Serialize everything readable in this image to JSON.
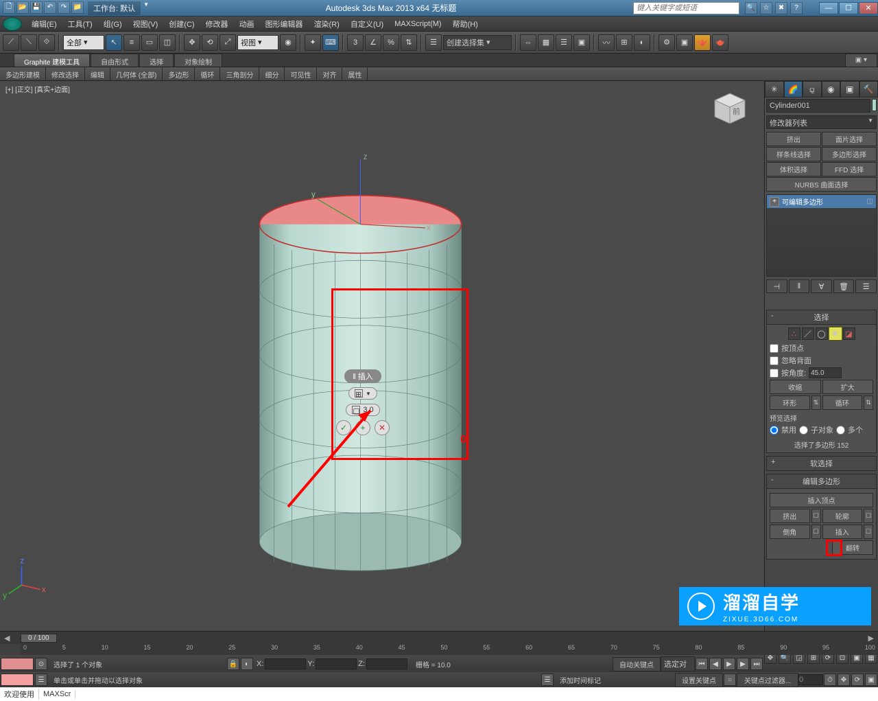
{
  "titlebar": {
    "workspace": "工作台: 默认",
    "app_title": "Autodesk 3ds Max  2013 x64     无标题",
    "search_placeholder": "键入关键字或短语"
  },
  "menu": {
    "items": [
      "编辑(E)",
      "工具(T)",
      "组(G)",
      "视图(V)",
      "创建(C)",
      "修改器",
      "动画",
      "图形编辑器",
      "渲染(R)",
      "自定义(U)",
      "MAXScript(M)",
      "帮助(H)"
    ]
  },
  "toolbar": {
    "sel_filter": "全部",
    "refcoord": "视图",
    "named_sel": "创建选择集"
  },
  "ribbon": {
    "tabs": [
      "Graphite 建模工具",
      "自由形式",
      "选择",
      "对象绘制"
    ],
    "sections": [
      "多边形建模",
      "修改选择",
      "编辑",
      "几何体 (全部)",
      "多边形",
      "循环",
      "三角剖分",
      "细分",
      "可见性",
      "对齐",
      "属性"
    ]
  },
  "viewport": {
    "label": "[+] [正交] [真实+边面]"
  },
  "caddy": {
    "title": "‖ 插入",
    "value": "3.0"
  },
  "cmdpanel": {
    "object_name": "Cylinder001",
    "modifier_list": "修改器列表",
    "mod_buttons": [
      "挤出",
      "面片选择",
      "样条线选择",
      "多边形选择",
      "体积选择",
      "FFD 选择"
    ],
    "nurbs_btn": "NURBS 曲面选择",
    "stack_item": "可编辑多边形",
    "rollouts": {
      "selection": {
        "title": "选择",
        "by_vertex": "按顶点",
        "ignore_backface": "忽略背面",
        "by_angle": "按角度:",
        "angle_value": "45.0",
        "shrink": "收缩",
        "grow": "扩大",
        "ring": "环形",
        "loop": "循环",
        "preview_label": "预览选择",
        "disable": "禁用",
        "subobj": "子对象",
        "multi": "多个",
        "selected_info": "选择了多边形 152"
      },
      "soft_selection": "软选择",
      "edit_polygons": {
        "title": "编辑多边形",
        "insert_vertex": "插入顶点",
        "extrude": "挤出",
        "outline": "轮廓",
        "bevel": "倒角",
        "inset": "插入",
        "flip": "翻转"
      }
    }
  },
  "timeline": {
    "frame_display": "0 / 100",
    "ticks": [
      "0",
      "5",
      "10",
      "15",
      "20",
      "25",
      "30",
      "35",
      "40",
      "45",
      "50",
      "55",
      "60",
      "65",
      "70",
      "75",
      "80",
      "85",
      "90",
      "95",
      "100"
    ]
  },
  "status": {
    "selected": "选择了 1 个对象",
    "prompt": "单击或单击并拖动以选择对象",
    "x_label": "X:",
    "y_label": "Y:",
    "z_label": "Z:",
    "grid": "栅格 = 10.0",
    "autokey": "自动关键点",
    "selected_kf": "选定对",
    "setkey": "设置关键点",
    "keyfilter": "关键点过滤器...",
    "add_marker": "添加时间标记"
  },
  "bottombar": {
    "welcome": "欢迎使用",
    "maxscr": "MAXScr"
  },
  "watermark": {
    "title": "溜溜自学",
    "url": "ZIXUE.3D66.COM"
  }
}
